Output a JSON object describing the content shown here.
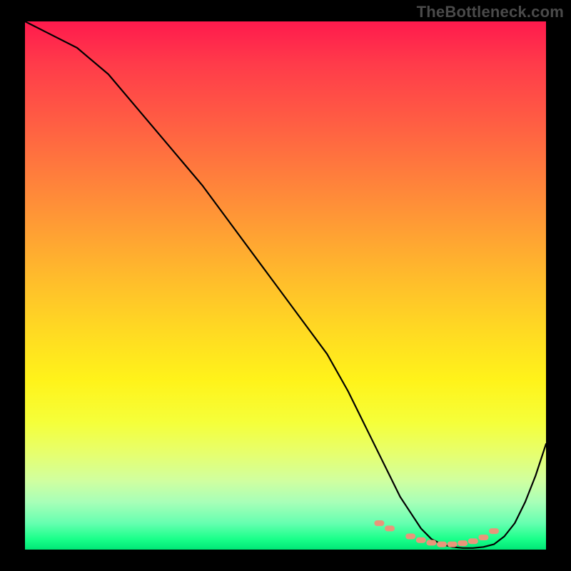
{
  "branding": {
    "watermark": "TheBottleneck.com"
  },
  "chart_data": {
    "type": "line",
    "title": "",
    "xlabel": "",
    "ylabel": "",
    "xlim": [
      0,
      100
    ],
    "ylim": [
      0,
      100
    ],
    "grid": false,
    "legend": false,
    "series": [
      {
        "name": "bottleneck-curve",
        "x": [
          0,
          4,
          10,
          16,
          22,
          28,
          34,
          40,
          46,
          52,
          58,
          62,
          66,
          68,
          70,
          72,
          74,
          76,
          78,
          80,
          82,
          84,
          86,
          88,
          90,
          92,
          94,
          96,
          98,
          100
        ],
        "y": [
          100,
          98,
          95,
          90,
          83,
          76,
          69,
          61,
          53,
          45,
          37,
          30,
          22,
          18,
          14,
          10,
          7,
          4,
          2,
          1,
          0.5,
          0.3,
          0.3,
          0.5,
          1,
          2.5,
          5,
          9,
          14,
          20
        ]
      }
    ],
    "markers": [
      {
        "name": "highlight-dots",
        "shape": "rounded-dash",
        "color": "#e9967a",
        "x": [
          68,
          70,
          74,
          76,
          78,
          80,
          82,
          84,
          86,
          88,
          90
        ],
        "y": [
          5,
          4,
          2.5,
          1.8,
          1.3,
          1.0,
          1.0,
          1.2,
          1.6,
          2.3,
          3.5
        ]
      }
    ],
    "gradient_stops": [
      {
        "pos": 0,
        "color": "#ff1a4d"
      },
      {
        "pos": 18,
        "color": "#ff5a44"
      },
      {
        "pos": 38,
        "color": "#ff9a35"
      },
      {
        "pos": 58,
        "color": "#ffd823"
      },
      {
        "pos": 76,
        "color": "#f5ff3a"
      },
      {
        "pos": 91,
        "color": "#a8ffb8"
      },
      {
        "pos": 100,
        "color": "#00e676"
      }
    ]
  }
}
